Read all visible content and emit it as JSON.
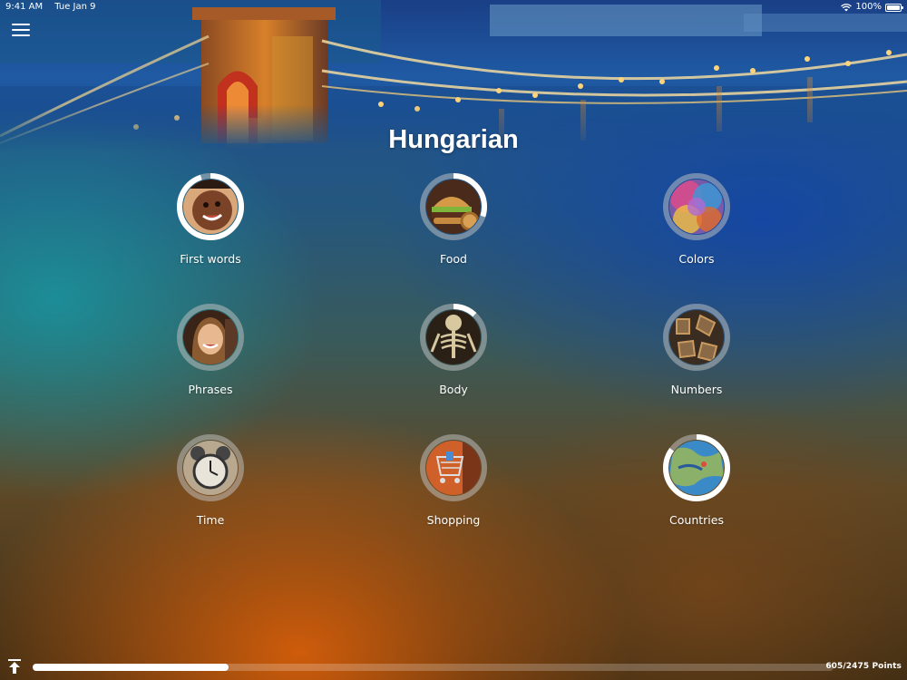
{
  "status_bar": {
    "time": "9:41 AM",
    "date": "Tue Jan 9",
    "battery": "100%",
    "icons": [
      "wifi-icon",
      "battery-icon"
    ]
  },
  "header": {
    "title": "Hungarian",
    "menu_icon": "hamburger-menu-icon",
    "banner_image": "chain-bridge-at-night"
  },
  "categories": [
    {
      "label": "First words",
      "progress": 0.95,
      "image": "smiling-child"
    },
    {
      "label": "Food",
      "progress": 0.3,
      "image": "burger"
    },
    {
      "label": "Colors",
      "progress": 0.0,
      "image": "color-powder"
    },
    {
      "label": "Phrases",
      "progress": 0.0,
      "image": "woman-smiling"
    },
    {
      "label": "Body",
      "progress": 0.12,
      "image": "skeleton"
    },
    {
      "label": "Numbers",
      "progress": 0.0,
      "image": "metal-numbers"
    },
    {
      "label": "Time",
      "progress": 0.0,
      "image": "alarm-clock"
    },
    {
      "label": "Shopping",
      "progress": 0.0,
      "image": "shopping-cart"
    },
    {
      "label": "Countries",
      "progress": 0.85,
      "image": "map"
    }
  ],
  "footer": {
    "points": "605/2475 Points",
    "progress": 0.2444,
    "scroll_top_icon": "scroll-to-top-icon"
  },
  "colors": {
    "accent": "#ffffff",
    "ring_track": "#c5c5c5",
    "progress_track": "rgba(255,255,255,0.22)"
  }
}
